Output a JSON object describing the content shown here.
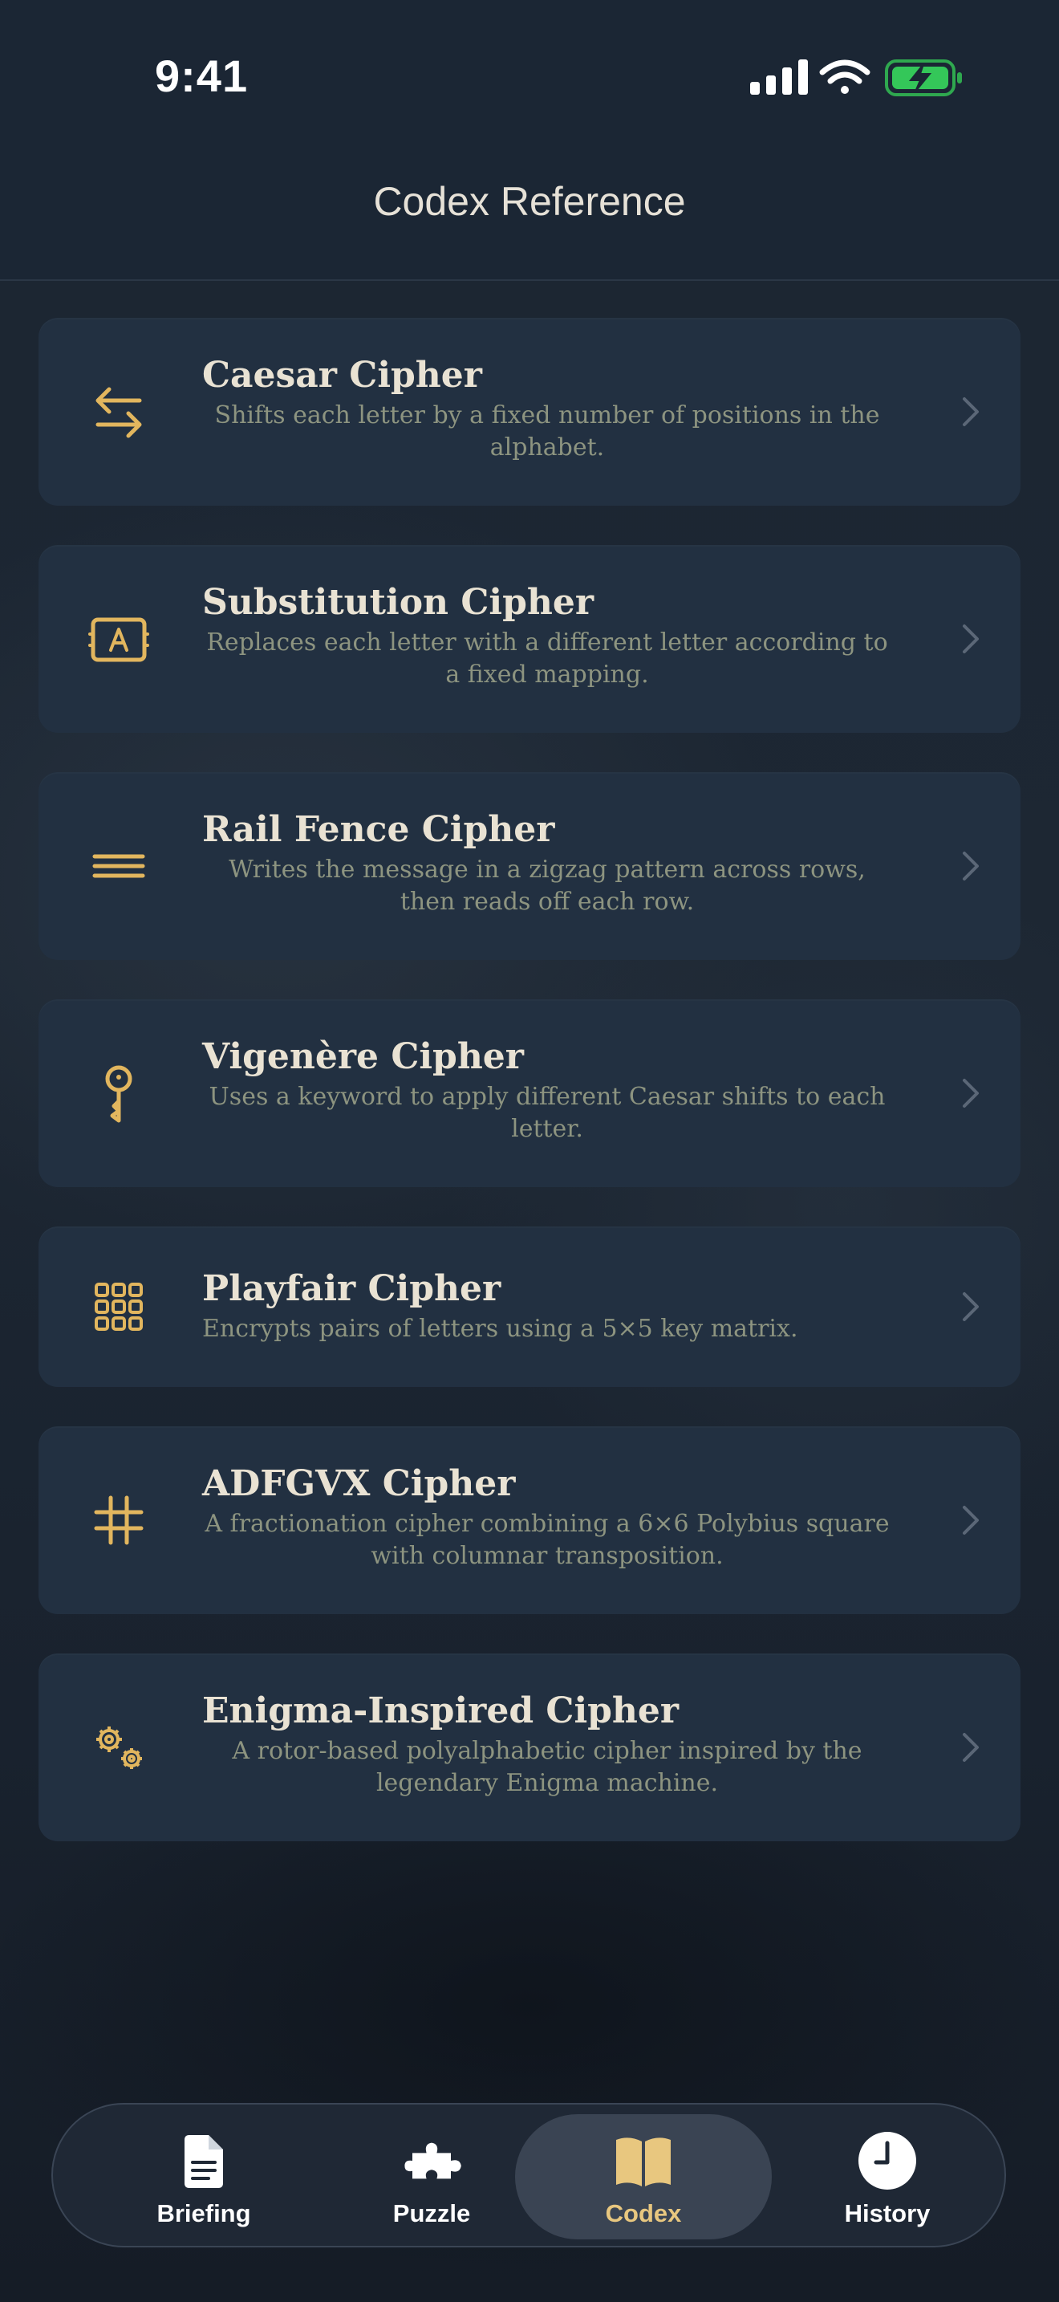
{
  "status_bar": {
    "time": "9:41"
  },
  "header": {
    "title": "Codex Reference"
  },
  "colors": {
    "accent": "#e2b65e",
    "card": "#223041",
    "title": "#e9e2d3",
    "desc": "#8d9480",
    "battery": "#34c759"
  },
  "ciphers": [
    {
      "title": "Caesar Cipher",
      "description": "Shifts each letter by a fixed number of positions in the alphabet.",
      "icon": "arrows-left-right-icon"
    },
    {
      "title": "Substitution Cipher",
      "description": "Replaces each letter with a different letter according to a fixed mapping.",
      "icon": "letter-a-box-icon"
    },
    {
      "title": "Rail Fence Cipher",
      "description": "Writes the message in a zigzag pattern across rows, then reads off each row.",
      "icon": "three-lines-icon"
    },
    {
      "title": "Vigenère Cipher",
      "description": "Uses a keyword to apply different Caesar shifts to each letter.",
      "icon": "key-icon"
    },
    {
      "title": "Playfair Cipher",
      "description": "Encrypts pairs of letters using a 5×5 key matrix.",
      "icon": "grid-icon"
    },
    {
      "title": "ADFGVX Cipher",
      "description": "A fractionation cipher combining a 6×6 Polybius square with columnar transposition.",
      "icon": "hash-icon"
    },
    {
      "title": "Enigma-Inspired Cipher",
      "description": "A rotor-based polyalphabetic cipher inspired by the legendary Enigma machine.",
      "icon": "gears-icon"
    }
  ],
  "tabs": [
    {
      "label": "Briefing",
      "icon": "document-icon",
      "active": false
    },
    {
      "label": "Puzzle",
      "icon": "puzzle-icon",
      "active": false
    },
    {
      "label": "Codex",
      "icon": "book-icon",
      "active": true
    },
    {
      "label": "History",
      "icon": "clock-icon",
      "active": false
    }
  ]
}
